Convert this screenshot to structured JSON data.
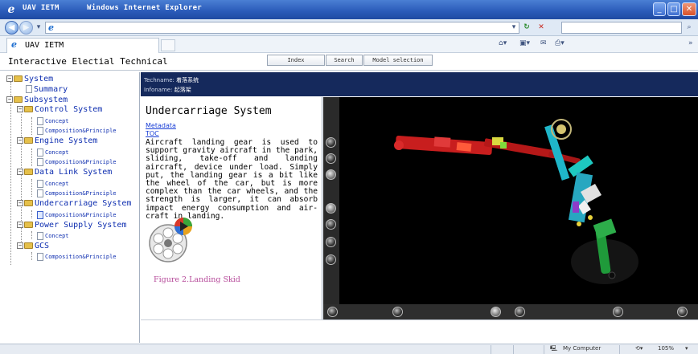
{
  "window": {
    "title": "UAV IETM      Windows Internet Explorer",
    "min_glyph": "_",
    "max_glyph": "□",
    "close_glyph": "✕"
  },
  "browser": {
    "address_icon": "e",
    "address_value": "",
    "search_placeholder": "",
    "tab_label": "UAV IETM",
    "zoom": "105%",
    "status_zone": "My Computer",
    "icons": [
      "back-icon",
      "forward-icon",
      "refresh-icon",
      "stop-icon",
      "search-icon",
      "home-icon",
      "feeds-icon",
      "mail-icon",
      "print-icon"
    ]
  },
  "app": {
    "title": "Interactive Electial Technical",
    "nav": {
      "index": "Index",
      "search": "Search",
      "model_selection": "Model selection"
    }
  },
  "tree": {
    "system": "System",
    "summary": "Summary",
    "subsystem": "Subsystem",
    "control_system": "Control System",
    "control_concept": "Concept",
    "control_comp": "Composition&Principle",
    "engine_system": "Engine System",
    "engine_concept": "Concept",
    "engine_comp": "Composition&Principle",
    "datalink_system": "Data Link System",
    "datalink_concept": "Concept",
    "datalink_comp": "Composition&Principle",
    "undercarriage_system": "Undercarriage System",
    "undercarriage_comp": "Composition&Principle",
    "power_system": "Power Supply System",
    "power_concept": "Concept",
    "gcs": "GCS",
    "gcs_comp": "Composition&Principle"
  },
  "content": {
    "techname_label": "Techname:",
    "techname_value": "着落系统",
    "infoname_label": "Infoname:",
    "infoname_value": "起落架",
    "section_title": "Undercarriage System",
    "link_metadata": "Metadata",
    "link_toc": "TOC",
    "body": "Aircraft landing gear is used to support gravity aircraft in the park, sliding, take-off and landing aircraft, device under load. Simply put, the landing gear is a bit like the wheel of the car, but is more complex than the car wheels, and the strength is larger, it can absorb impact energy consumption and air-craft in landing.",
    "figure_caption": "Figure 2.Landing Skid"
  },
  "colors": {
    "titlebar": "#2a5ab8",
    "content_header": "#15295c",
    "tree_text": "#0f2fb0",
    "caption": "#b64a9a",
    "strut_red": "#c81e1e",
    "strut_cyan": "#1ec8c0",
    "wheel_green": "#1f9a3a"
  }
}
